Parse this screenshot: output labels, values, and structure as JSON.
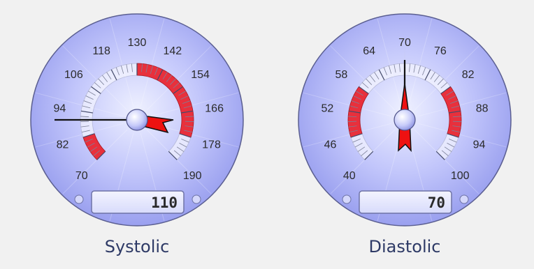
{
  "gauges": [
    {
      "id": "systolic",
      "title": "Systolic",
      "value": 110,
      "display": "110",
      "min": 70,
      "max": 190,
      "tick_labels": [
        "70",
        "82",
        "94",
        "106",
        "118",
        "130",
        "142",
        "154",
        "166",
        "178",
        "190"
      ],
      "red_bands": [
        [
          70,
          82
        ],
        [
          130,
          178
        ]
      ]
    },
    {
      "id": "diastolic",
      "title": "Diastolic",
      "value": 70,
      "display": "70",
      "min": 40,
      "max": 100,
      "tick_labels": [
        "40",
        "46",
        "52",
        "58",
        "64",
        "70",
        "76",
        "82",
        "88",
        "94",
        "100"
      ],
      "red_bands": [
        [
          46,
          58
        ],
        [
          82,
          94
        ]
      ]
    }
  ],
  "colors": {
    "background": "#f1f1f1",
    "dial": "#a3a8f2",
    "dial_edge": "#b9bdf7",
    "band_red": "#e8303c",
    "needle_red": "#ee1111",
    "title_text": "#2e3a66"
  }
}
